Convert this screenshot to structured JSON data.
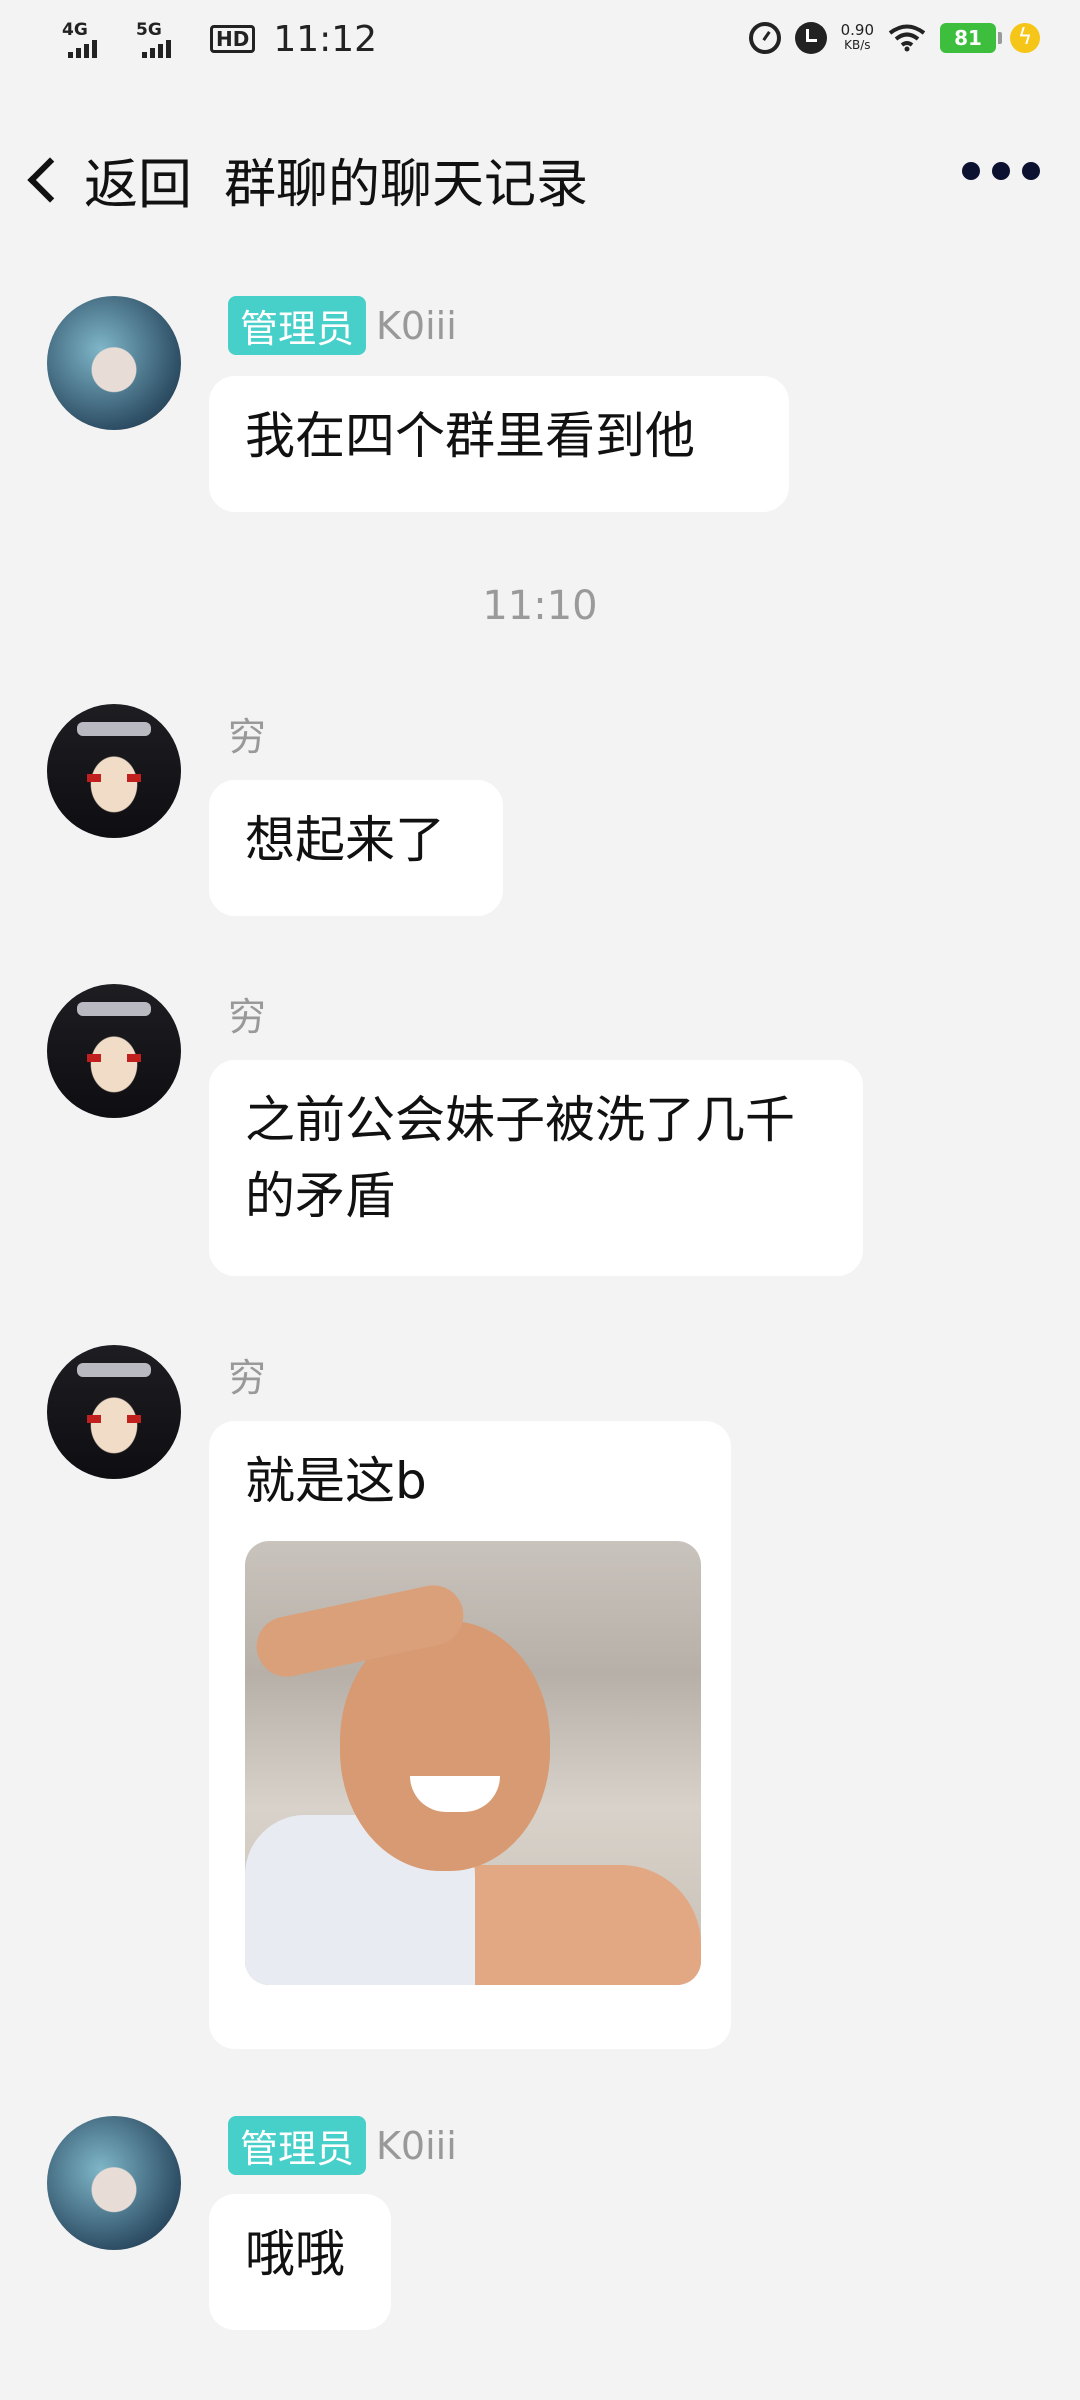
{
  "status_bar": {
    "signal_1": "4G",
    "signal_2": "5G",
    "hd": "HD",
    "time": "11:12",
    "net_speed_value": "0.90",
    "net_speed_unit": "KB/s",
    "battery": "81"
  },
  "nav": {
    "back_label": "返回",
    "title": "群聊的聊天记录"
  },
  "messages": [
    {
      "role_badge": "管理员",
      "sender": "K0iii",
      "text": "我在四个群里看到他"
    },
    {
      "sender": "穷",
      "text": "想起来了"
    },
    {
      "sender": "穷",
      "text": "之前公会妹子被洗了几千的矛盾"
    },
    {
      "sender": "穷",
      "text": "就是这b"
    },
    {
      "role_badge": "管理员",
      "sender": "K0iii",
      "text": "哦哦"
    }
  ],
  "timestamp": "11:10",
  "colors": {
    "background": "#f3f3f3",
    "bubble": "#ffffff",
    "admin_badge": "#47cfc9",
    "battery": "#3dbf3d"
  }
}
